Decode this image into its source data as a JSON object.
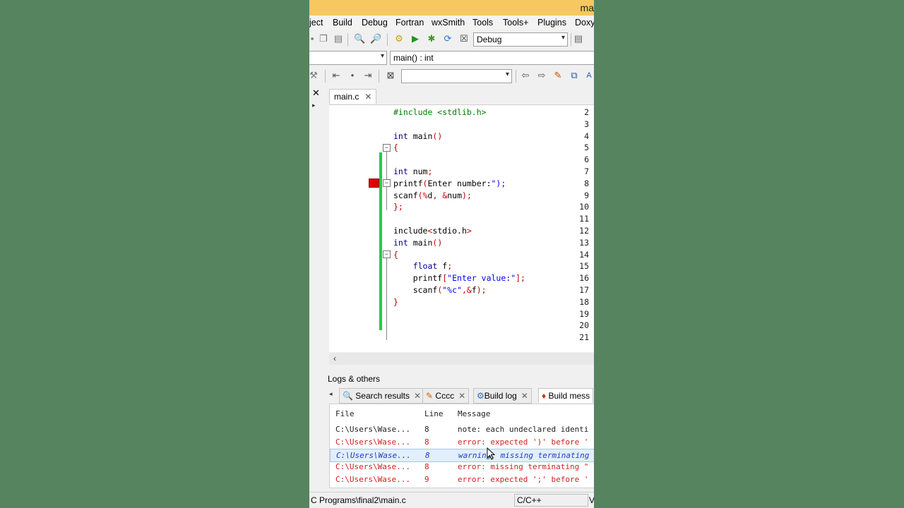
{
  "window": {
    "title_fragment": "ma"
  },
  "menu": [
    "ject",
    "Build",
    "Debug",
    "Fortran",
    "wxSmith",
    "Tools",
    "Tools+",
    "Plugins",
    "Doxy("
  ],
  "toolbar": {
    "build_target": "Debug"
  },
  "scope_bar": {
    "function": "main() : int"
  },
  "editor": {
    "tab_label": "main.c",
    "lines": [
      {
        "n": "2",
        "html": "<span class='pp'>#include &lt;stdlib.h&gt;</span>"
      },
      {
        "n": "3",
        "html": ""
      },
      {
        "n": "4",
        "html": "<span class='kw'>int</span> main<span class='sym'>()</span>"
      },
      {
        "n": "5",
        "html": "<span class='sym'>{</span>"
      },
      {
        "n": "6",
        "html": ""
      },
      {
        "n": "7",
        "html": "<span class='kw'>int</span> num<span class='sym'>;</span>"
      },
      {
        "n": "8",
        "html": "printf<span class='sym'>(</span>Enter number:<span class='str'>\");</span>"
      },
      {
        "n": "9",
        "html": "scanf<span class='sym'>(</span><span class='sym'>%</span>d<span class='sym'>,</span> <span class='sym'>&amp;</span>num<span class='sym'>);</span>"
      },
      {
        "n": "10",
        "html": "<span class='sym'>};</span>"
      },
      {
        "n": "11",
        "html": ""
      },
      {
        "n": "12",
        "html": "include<span class='sym'>&lt;</span>stdio.h<span class='sym'>&gt;</span>"
      },
      {
        "n": "13",
        "html": "<span class='kw'>int</span> main<span class='sym'>()</span>"
      },
      {
        "n": "14",
        "html": "<span class='sym'>{</span>"
      },
      {
        "n": "15",
        "html": "    <span class='kw'>float</span> f<span class='sym'>;</span>"
      },
      {
        "n": "16",
        "html": "    printf<span class='sym'>[</span><span class='str'>\"Enter value:\"</span><span class='sym'>];</span>"
      },
      {
        "n": "17",
        "html": "    scanf<span class='sym'>(</span><span class='str'>\"%c\"</span><span class='sym'>,&amp;</span>f<span class='sym'>);</span>"
      },
      {
        "n": "18",
        "html": "<span class='sym'>}</span>"
      },
      {
        "n": "19",
        "html": ""
      },
      {
        "n": "20",
        "html": ""
      },
      {
        "n": "21",
        "html": ""
      }
    ]
  },
  "logs": {
    "title": "Logs & others",
    "tabs": [
      "Search results",
      "Cccc",
      "Build log",
      "Build mess"
    ],
    "columns": [
      "File",
      "Line",
      "Message"
    ],
    "rows": [
      {
        "file": "C:\\Users\\Wase...",
        "line": "8",
        "msg": "note: each undeclared identi",
        "kind": "note"
      },
      {
        "file": "C:\\Users\\Wase...",
        "line": "8",
        "msg": "error: expected ')' before '",
        "kind": "err"
      },
      {
        "file": "C:\\Users\\Wase...",
        "line": "8",
        "msg": "warning: missing terminating",
        "kind": "sel"
      },
      {
        "file": "C:\\Users\\Wase...",
        "line": "8",
        "msg": "error: missing terminating \"",
        "kind": "err"
      },
      {
        "file": "C:\\Users\\Wase...",
        "line": "9",
        "msg": "error: expected ';' before '",
        "kind": "err"
      }
    ]
  },
  "status": {
    "path": "C Programs\\final2\\main.c",
    "language": "C/C++",
    "tail": "V"
  }
}
